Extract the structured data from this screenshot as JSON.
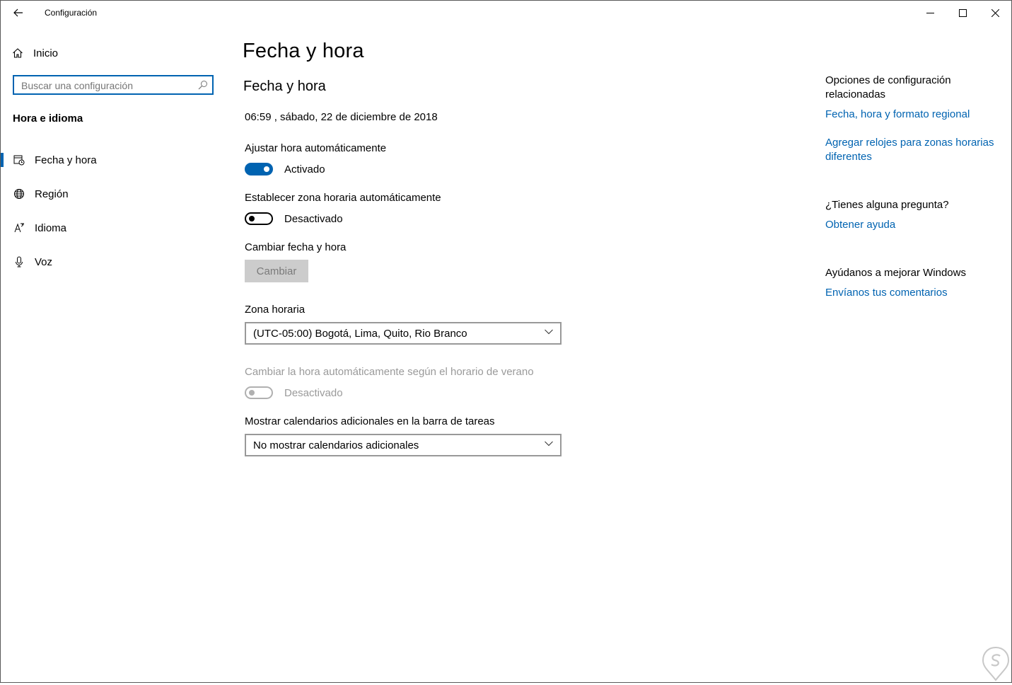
{
  "window": {
    "title": "Configuración"
  },
  "sidebar": {
    "home_label": "Inicio",
    "search_placeholder": "Buscar una configuración",
    "section_title": "Hora e idioma",
    "items": [
      {
        "label": "Fecha y hora",
        "icon": "calendar-clock-icon",
        "selected": true
      },
      {
        "label": "Región",
        "icon": "globe-icon",
        "selected": false
      },
      {
        "label": "Idioma",
        "icon": "language-icon",
        "selected": false
      },
      {
        "label": "Voz",
        "icon": "microphone-icon",
        "selected": false
      }
    ]
  },
  "main": {
    "page_title": "Fecha y hora",
    "section_title": "Fecha y hora",
    "current_datetime": "06:59 , sábado, 22 de diciembre de 2018",
    "auto_time": {
      "label": "Ajustar hora automáticamente",
      "state_label": "Activado",
      "on": true
    },
    "auto_timezone": {
      "label": "Establecer zona horaria automáticamente",
      "state_label": "Desactivado",
      "on": false
    },
    "change_datetime": {
      "label": "Cambiar fecha y hora",
      "button_label": "Cambiar"
    },
    "timezone": {
      "label": "Zona horaria",
      "value": "(UTC-05:00) Bogotá, Lima, Quito, Rio Branco"
    },
    "dst": {
      "label": "Cambiar la hora automáticamente según el horario de verano",
      "state_label": "Desactivado",
      "on": false,
      "disabled": true
    },
    "calendars": {
      "label": "Mostrar calendarios adicionales en la barra de tareas",
      "value": "No mostrar calendarios adicionales"
    }
  },
  "related": {
    "title": "Opciones de configuración relacionadas",
    "links": [
      "Fecha, hora y formato regional",
      "Agregar relojes para zonas horarias diferentes"
    ],
    "question_title": "¿Tienes alguna pregunta?",
    "help_link": "Obtener ayuda",
    "improve_title": "Ayúdanos a mejorar Windows",
    "feedback_link": "Envíanos tus comentarios"
  },
  "colors": {
    "accent": "#0063b1",
    "disabled": "#9a9a9a"
  }
}
